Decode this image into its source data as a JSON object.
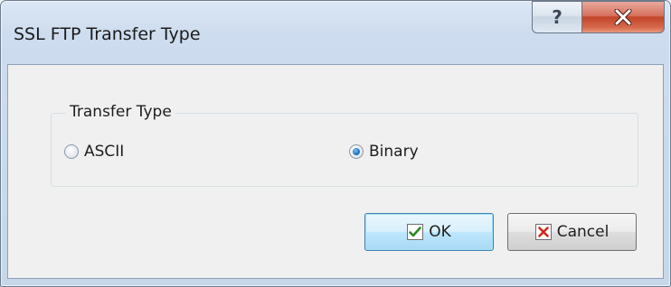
{
  "window": {
    "title": "SSL FTP Transfer Type",
    "help_glyph": "?",
    "close_glyph": "X"
  },
  "group": {
    "label": "Transfer Type",
    "options": [
      {
        "label": "ASCII",
        "checked": false
      },
      {
        "label": "Binary",
        "checked": true
      }
    ]
  },
  "buttons": {
    "ok_label": "OK",
    "cancel_label": "Cancel"
  },
  "icons": {
    "ok": "check-icon",
    "cancel": "x-icon",
    "help": "question-mark-icon",
    "close": "close-icon"
  },
  "colors": {
    "check": "#2d8a1f",
    "cancel_x": "#d1281b",
    "close_button": "#c24428",
    "radio_selected": "#1e6fc4"
  }
}
